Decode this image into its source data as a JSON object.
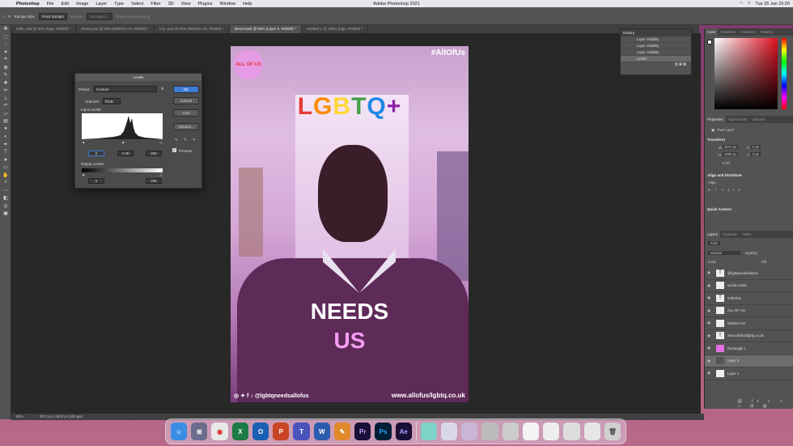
{
  "menubar": {
    "app": "Photoshop",
    "items": [
      "File",
      "Edit",
      "Image",
      "Layer",
      "Type",
      "Select",
      "Filter",
      "3D",
      "View",
      "Plugins",
      "Window",
      "Help"
    ],
    "title": "Adobe Photoshop 2021",
    "clock": "Tue 25 Jan  15:20"
  },
  "options": {
    "sample_size_label": "Sample Size:",
    "sample_size_value": "Point Sample",
    "sample_label": "Sample:",
    "sample_value": "All Layers",
    "show_ring": "Show Sampling Ring"
  },
  "tabs": [
    "edith .psd @ 50% (logo, RGB/8) *",
    "emma.psd @ 50% (NEEDS US, RGB/8) *",
    "rory .psd @ 50% (NEEDS  US, RGB/8) *",
    "denzel.psd @ 50% (Layer 2, RGB/8) *",
    "Untitled-1 @ 100% (logo, RGB/8) *"
  ],
  "poster": {
    "badge": "ALL OF US",
    "hashtag": "#AllOfUs",
    "lgbtq": [
      "L",
      "G",
      "B",
      "T",
      "Q",
      "+"
    ],
    "needs": "NEEDS",
    "us": "US",
    "social": "@lgbtqneedsallofus",
    "url": "www.allofus/lgbtq.co.uk"
  },
  "levels": {
    "title": "Levels",
    "preset_label": "Preset:",
    "preset_value": "Custom",
    "channel_label": "Channel:",
    "channel_value": "RGB",
    "input_label": "Input Levels:",
    "in_black": "0",
    "in_mid": "1.00",
    "in_white": "255",
    "output_label": "Output Levels:",
    "out_black": "0",
    "out_white": "255",
    "ok": "OK",
    "cancel": "Cancel",
    "auto": "Auto",
    "options": "Options...",
    "preview": "Preview"
  },
  "history": {
    "tabs": [
      "History"
    ],
    "items": [
      "Layer Visibility",
      "Layer Visibility",
      "Layer Visibility",
      "Levels"
    ]
  },
  "color_tabs": [
    "Color",
    "Swatches",
    "Gradients",
    "Patterns"
  ],
  "props": {
    "tabs": [
      "Properties",
      "Adjustments",
      "Libraries"
    ],
    "kind": "Pixel Layer",
    "transform": "Transform",
    "w_label": "W",
    "w": "3072 px",
    "h_label": "H",
    "h": "4608 px",
    "x_label": "X",
    "x": "0 px",
    "y_label": "Y",
    "y": "0 px",
    "angle": "0.00°",
    "align": "Align and Distribute",
    "align_sub": "Align:",
    "quick": "Quick Actions"
  },
  "layers_panel": {
    "tabs": [
      "Layers",
      "Channels",
      "Paths"
    ],
    "kind": "Kind",
    "blend": "Normal",
    "opacity": "Opacity:",
    "lock": "Lock:",
    "fill": "Fill:",
    "layers": [
      {
        "name": "@lgbtqneedsallofus",
        "type": "T"
      },
      {
        "name": "social media",
        "type": ""
      },
      {
        "name": "#AllOfUs",
        "type": "T"
      },
      {
        "name": "ALL OF US",
        "type": ""
      },
      {
        "name": "NEEDS  US",
        "type": ""
      },
      {
        "name": "www.allofus/lgbtq.co.uk",
        "type": "T"
      },
      {
        "name": "Rectangle 1",
        "type": ""
      },
      {
        "name": "Layer 2",
        "type": ""
      },
      {
        "name": "Layer 1",
        "type": ""
      }
    ]
  },
  "status": {
    "zoom": "50%",
    "info": "3072 px x 4608 px (300 ppi)"
  },
  "dock": [
    "Finder",
    "Launchpad",
    "Chrome",
    "Excel",
    "Outlook",
    "PowerPoint",
    "Teams",
    "Word",
    "Pages",
    "Premiere",
    "Photoshop",
    "After Effects"
  ]
}
